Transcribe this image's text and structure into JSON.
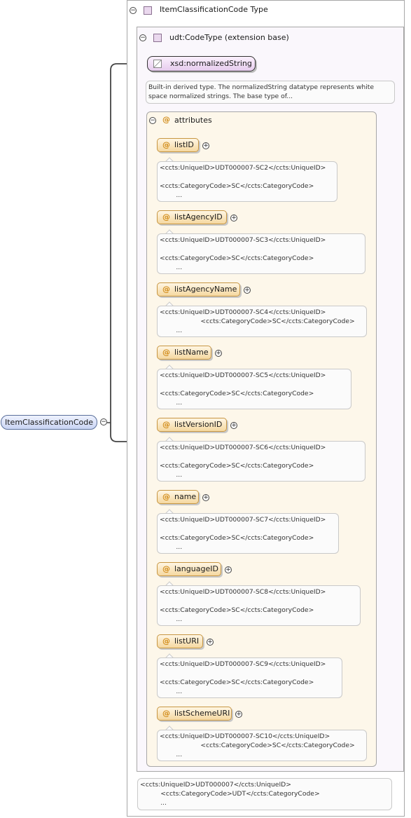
{
  "root": {
    "label": "ItemClassificationCode"
  },
  "type_box": {
    "title": "ItemClassificationCode Type"
  },
  "extension": {
    "title": "udt:CodeType (extension base)"
  },
  "base": {
    "label": "xsd:normalizedString",
    "doc": "Built-in derived type. The normalizedString datatype represents white space normalized strings. The base type of..."
  },
  "attributes_group": {
    "label": "attributes"
  },
  "attributes": [
    {
      "name": "listID",
      "doc": "<ccts:UniqueID>UDT000007-SC2</ccts:UniqueID>\n\n<ccts:CategoryCode>SC</ccts:CategoryCode>\n        ..."
    },
    {
      "name": "listAgencyID",
      "doc": "<ccts:UniqueID>UDT000007-SC3</ccts:UniqueID>\n\n<ccts:CategoryCode>SC</ccts:CategoryCode>\n        ..."
    },
    {
      "name": "listAgencyName",
      "doc": "<ccts:UniqueID>UDT000007-SC4</ccts:UniqueID>\n                    <ccts:CategoryCode>SC</ccts:CategoryCode>\n        ..."
    },
    {
      "name": "listName",
      "doc": "<ccts:UniqueID>UDT000007-SC5</ccts:UniqueID>\n\n<ccts:CategoryCode>SC</ccts:CategoryCode>\n        ..."
    },
    {
      "name": "listVersionID",
      "doc": "<ccts:UniqueID>UDT000007-SC6</ccts:UniqueID>\n\n<ccts:CategoryCode>SC</ccts:CategoryCode>\n        ..."
    },
    {
      "name": "name",
      "doc": "<ccts:UniqueID>UDT000007-SC7</ccts:UniqueID>\n\n<ccts:CategoryCode>SC</ccts:CategoryCode>\n        ..."
    },
    {
      "name": "languageID",
      "doc": "<ccts:UniqueID>UDT000007-SC8</ccts:UniqueID>\n\n<ccts:CategoryCode>SC</ccts:CategoryCode>\n        ..."
    },
    {
      "name": "listURI",
      "doc": "<ccts:UniqueID>UDT000007-SC9</ccts:UniqueID>\n\n<ccts:CategoryCode>SC</ccts:CategoryCode>\n        ..."
    },
    {
      "name": "listSchemeURI",
      "doc": "<ccts:UniqueID>UDT000007-SC10</ccts:UniqueID>\n                    <ccts:CategoryCode>SC</ccts:CategoryCode>\n        ..."
    }
  ],
  "type_doc": "<ccts:UniqueID>UDT000007</ccts:UniqueID>\n          <ccts:CategoryCode>UDT</ccts:CategoryCode>\n          ...",
  "glyphs": {
    "collapse": "−",
    "expand": "+",
    "attribute": "@"
  }
}
